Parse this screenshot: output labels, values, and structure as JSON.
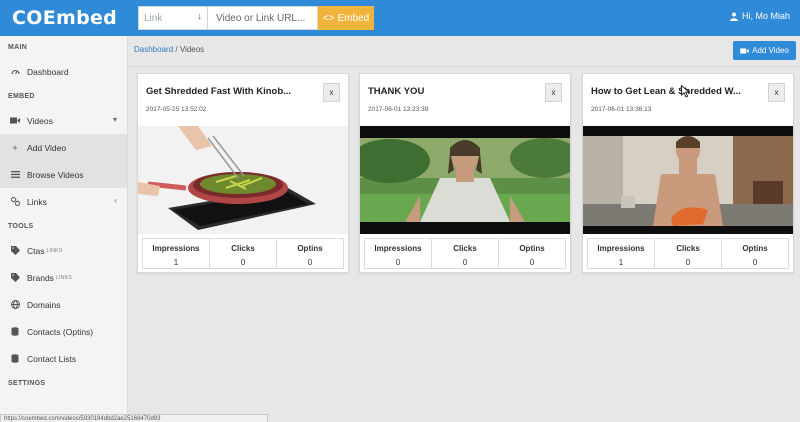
{
  "app": {
    "logo": "COEmbed"
  },
  "embed_bar": {
    "type_placeholder": "Link",
    "url_placeholder": "Video or Link URL...",
    "embed_label": "Embed"
  },
  "user": {
    "greeting": "Hi, Mo Miah"
  },
  "sidebar": {
    "main_header": "MAIN",
    "dashboard": "Dashboard",
    "embed_header": "EMBED",
    "videos": "Videos",
    "add_video": "Add Video",
    "browse_videos": "Browse Videos",
    "links": "Links",
    "tools_header": "TOOLS",
    "ctas": "Ctas",
    "ctas_sub": "LINKS",
    "brands": "Brands",
    "brands_sub": "LINKS",
    "domains": "Domains",
    "contacts": "Contacts (Optins)",
    "contact_lists": "Contact Lists",
    "settings_header": "SETTINGS"
  },
  "breadcrumb": {
    "home": "Dashboard",
    "separator": "/",
    "current": "Videos"
  },
  "toolbar": {
    "add_video_label": "Add Video"
  },
  "stat_labels": {
    "impressions": "Impressions",
    "clicks": "Clicks",
    "optins": "Optins"
  },
  "cards": [
    {
      "title": "Get Shredded Fast With Kinob...",
      "date": "2017-05-25 13:52:02",
      "close": "x",
      "impressions": "1",
      "clicks": "0",
      "optins": "0"
    },
    {
      "title": "THANK YOU",
      "date": "2017-06-01 13:23:39",
      "close": "x",
      "impressions": "0",
      "clicks": "0",
      "optins": "0"
    },
    {
      "title": "How to Get Lean & Shredded W...",
      "date": "2017-06-01 13:36:13",
      "close": "x",
      "impressions": "1",
      "clicks": "0",
      "optins": "0"
    }
  ],
  "status_bar": {
    "url": "https://coembed.com/videos/5930184dbd2ae25168470d93"
  },
  "colors": {
    "topbar": "#2f8ad7",
    "embed_button": "#f0b43d",
    "link": "#2f7bc0"
  },
  "icons": {
    "dashboard": "gauge-icon",
    "videos": "video-camera-icon",
    "add_video": "plus-icon",
    "browse_videos": "list-icon",
    "links": "link-icon",
    "ctas": "tag-icon",
    "brands": "tag-icon",
    "domains": "globe-icon",
    "contacts": "database-icon",
    "contact_lists": "database-icon",
    "user": "user-icon"
  }
}
